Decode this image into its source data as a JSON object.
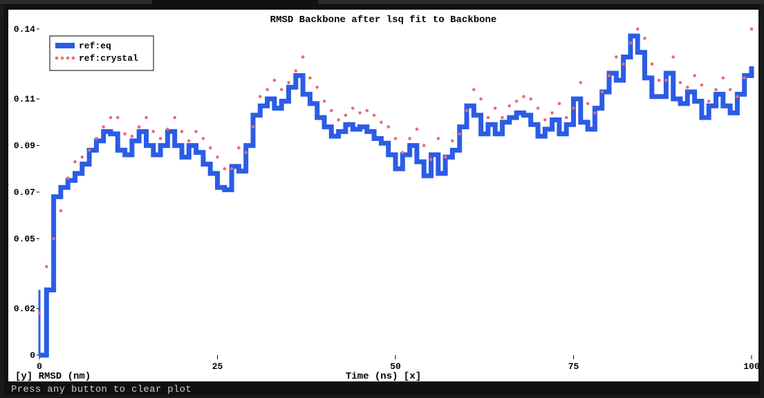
{
  "footer": {
    "prompt": "Press any button to clear plot"
  },
  "chart_data": {
    "type": "line",
    "title": "RMSD Backbone after lsq fit to Backbone",
    "xlabel": "Time (ns) [x]",
    "ylabel": "[y] RMSD (nm)",
    "xlim": [
      0,
      100
    ],
    "ylim": [
      0,
      0.14
    ],
    "x_ticks": [
      0,
      25,
      50,
      75,
      100
    ],
    "y_ticks": [
      0,
      0.02,
      0.05,
      0.07,
      0.09,
      0.11,
      0.14
    ],
    "legend_position": "upper-left",
    "colors": {
      "ref:eq": "#2b5ce6",
      "ref:crystal": "#e96b7b"
    },
    "x": [
      0,
      1,
      2,
      3,
      4,
      5,
      6,
      7,
      8,
      9,
      10,
      11,
      12,
      13,
      14,
      15,
      16,
      17,
      18,
      19,
      20,
      21,
      22,
      23,
      24,
      25,
      26,
      27,
      28,
      29,
      30,
      31,
      32,
      33,
      34,
      35,
      36,
      37,
      38,
      39,
      40,
      41,
      42,
      43,
      44,
      45,
      46,
      47,
      48,
      49,
      50,
      51,
      52,
      53,
      54,
      55,
      56,
      57,
      58,
      59,
      60,
      61,
      62,
      63,
      64,
      65,
      66,
      67,
      68,
      69,
      70,
      71,
      72,
      73,
      74,
      75,
      76,
      77,
      78,
      79,
      80,
      81,
      82,
      83,
      84,
      85,
      86,
      87,
      88,
      89,
      90,
      91,
      92,
      93,
      94,
      95,
      96,
      97,
      98,
      99,
      100
    ],
    "series": [
      {
        "name": "ref:eq",
        "style": "steps",
        "values": [
          0.0,
          0.028,
          0.068,
          0.072,
          0.075,
          0.078,
          0.082,
          0.088,
          0.092,
          0.096,
          0.095,
          0.088,
          0.086,
          0.092,
          0.096,
          0.09,
          0.086,
          0.09,
          0.096,
          0.09,
          0.085,
          0.09,
          0.087,
          0.082,
          0.078,
          0.072,
          0.071,
          0.081,
          0.079,
          0.09,
          0.103,
          0.107,
          0.11,
          0.106,
          0.109,
          0.115,
          0.12,
          0.112,
          0.108,
          0.102,
          0.098,
          0.094,
          0.096,
          0.099,
          0.097,
          0.098,
          0.096,
          0.093,
          0.091,
          0.086,
          0.08,
          0.086,
          0.09,
          0.083,
          0.077,
          0.086,
          0.078,
          0.085,
          0.088,
          0.098,
          0.107,
          0.103,
          0.095,
          0.099,
          0.095,
          0.1,
          0.102,
          0.104,
          0.103,
          0.099,
          0.094,
          0.097,
          0.101,
          0.095,
          0.099,
          0.11,
          0.1,
          0.097,
          0.106,
          0.113,
          0.121,
          0.118,
          0.128,
          0.137,
          0.13,
          0.119,
          0.111,
          0.111,
          0.121,
          0.11,
          0.108,
          0.113,
          0.109,
          0.102,
          0.107,
          0.112,
          0.107,
          0.104,
          0.112,
          0.12,
          0.124
        ]
      },
      {
        "name": "ref:crystal",
        "style": "dots",
        "values": [
          0.018,
          0.038,
          0.05,
          0.062,
          0.076,
          0.083,
          0.085,
          0.088,
          0.093,
          0.098,
          0.102,
          0.102,
          0.095,
          0.094,
          0.098,
          0.102,
          0.096,
          0.093,
          0.097,
          0.102,
          0.096,
          0.092,
          0.096,
          0.093,
          0.089,
          0.085,
          0.08,
          0.08,
          0.089,
          0.087,
          0.098,
          0.111,
          0.114,
          0.118,
          0.114,
          0.117,
          0.122,
          0.128,
          0.119,
          0.115,
          0.109,
          0.105,
          0.101,
          0.103,
          0.106,
          0.104,
          0.105,
          0.103,
          0.1,
          0.098,
          0.093,
          0.087,
          0.093,
          0.097,
          0.09,
          0.084,
          0.093,
          0.085,
          0.092,
          0.095,
          0.105,
          0.114,
          0.11,
          0.102,
          0.106,
          0.102,
          0.107,
          0.109,
          0.111,
          0.11,
          0.106,
          0.101,
          0.104,
          0.108,
          0.102,
          0.106,
          0.117,
          0.108,
          0.104,
          0.113,
          0.12,
          0.128,
          0.125,
          0.134,
          0.14,
          0.136,
          0.125,
          0.118,
          0.118,
          0.128,
          0.117,
          0.115,
          0.12,
          0.116,
          0.109,
          0.114,
          0.119,
          0.114,
          0.111,
          0.119,
          0.14
        ]
      }
    ]
  }
}
